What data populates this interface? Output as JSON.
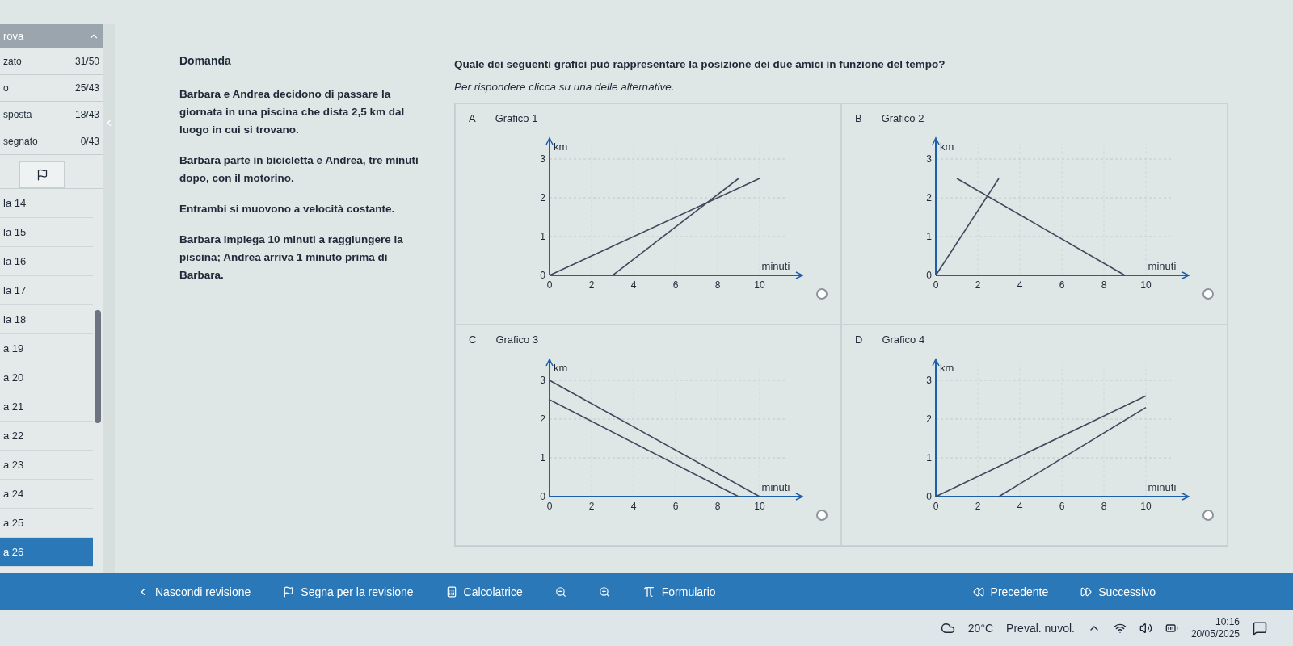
{
  "sidebar": {
    "header": "rova",
    "expanded": true,
    "summary": [
      {
        "label": "zato",
        "count": "31/50"
      },
      {
        "label": "o",
        "count": "25/43"
      },
      {
        "label": "sposta",
        "count": "18/43"
      },
      {
        "label": "segnato",
        "count": "0/43"
      }
    ],
    "questions": [
      {
        "label": "la 14",
        "selected": false
      },
      {
        "label": "la 15",
        "selected": false
      },
      {
        "label": "la 16",
        "selected": false
      },
      {
        "label": "la 17",
        "selected": false
      },
      {
        "label": "la 18",
        "selected": false
      },
      {
        "label": "a 19",
        "selected": false
      },
      {
        "label": "a 20",
        "selected": false
      },
      {
        "label": "a 21",
        "selected": false
      },
      {
        "label": "a 22",
        "selected": false
      },
      {
        "label": "a 23",
        "selected": false
      },
      {
        "label": "a 24",
        "selected": false
      },
      {
        "label": "a 25",
        "selected": false
      },
      {
        "label": "a 26",
        "selected": true
      }
    ]
  },
  "question": {
    "title": "Domanda",
    "paragraphs": [
      "Barbara e Andrea decidono di passare la giornata in una piscina che dista 2,5 km dal luogo in cui si trovano.",
      "Barbara parte in bicicletta e Andrea, tre minuti dopo, con il motorino.",
      "Entrambi si muovono a velocità costante.",
      "Barbara impiega 10 minuti a raggiungere la piscina; Andrea arriva 1 minuto prima di Barbara."
    ]
  },
  "answer": {
    "prompt": "Quale dei seguenti grafici può rappresentare la posizione dei due amici in funzione del tempo?",
    "hint": "Per rispondere clicca su una delle alternative.",
    "options": [
      {
        "letter": "A",
        "title": "Grafico 1",
        "selected": false,
        "chart_data": {
          "type": "line",
          "xlabel": "minuti",
          "ylabel": "km",
          "x": [
            0,
            3,
            9,
            10
          ],
          "series": [
            {
              "color": "#3d4a5c",
              "values": [
                0,
                0.75,
                2.25,
                2.5
              ]
            },
            {
              "color": "#3d4a5c",
              "values": [
                null,
                0,
                2.5,
                null
              ]
            }
          ],
          "grid": true,
          "xlim": [
            0,
            12
          ],
          "ylim": [
            0,
            3.5
          ],
          "xticks": [
            0,
            2,
            4,
            6,
            8,
            10
          ],
          "yticks": [
            0,
            1,
            2,
            3
          ]
        }
      },
      {
        "letter": "B",
        "title": "Grafico 2",
        "selected": false,
        "chart_data": {
          "type": "line",
          "xlabel": "minuti",
          "ylabel": "km",
          "x": [
            0,
            1,
            3,
            9
          ],
          "series": [
            {
              "color": "#3d4a5c",
              "values": [
                0,
                null,
                2.5,
                null
              ]
            },
            {
              "color": "#3d4a5c",
              "values": [
                null,
                2.5,
                null,
                0
              ]
            }
          ],
          "grid": true,
          "xlim": [
            0,
            12
          ],
          "ylim": [
            0,
            3.5
          ],
          "xticks": [
            0,
            2,
            4,
            6,
            8,
            10
          ],
          "yticks": [
            0,
            1,
            2,
            3
          ]
        }
      },
      {
        "letter": "C",
        "title": "Grafico 3",
        "selected": false,
        "chart_data": {
          "type": "line",
          "xlabel": "minuti",
          "ylabel": "km",
          "x": [
            0,
            9,
            10
          ],
          "series": [
            {
              "color": "#3d4a5c",
              "values": [
                3,
                null,
                0
              ]
            },
            {
              "color": "#3d4a5c",
              "values": [
                2.5,
                0,
                null
              ]
            }
          ],
          "grid": true,
          "xlim": [
            0,
            12
          ],
          "ylim": [
            0,
            3.5
          ],
          "xticks": [
            0,
            2,
            4,
            6,
            8,
            10
          ],
          "yticks": [
            0,
            1,
            2,
            3
          ]
        }
      },
      {
        "letter": "D",
        "title": "Grafico 4",
        "selected": false,
        "chart_data": {
          "type": "line",
          "xlabel": "minuti",
          "ylabel": "km",
          "x": [
            0,
            3,
            10
          ],
          "series": [
            {
              "color": "#3d4a5c",
              "values": [
                0,
                null,
                2.6
              ]
            },
            {
              "color": "#3d4a5c",
              "values": [
                null,
                0,
                2.3
              ]
            }
          ],
          "grid": true,
          "xlim": [
            0,
            12
          ],
          "ylim": [
            0,
            3.5
          ],
          "xticks": [
            0,
            2,
            4,
            6,
            8,
            10
          ],
          "yticks": [
            0,
            1,
            2,
            3
          ]
        }
      }
    ]
  },
  "toolbar": {
    "hide_review": "Nascondi revisione",
    "flag": "Segna per la revisione",
    "calculator": "Calcolatrice",
    "formulas": "Formulario",
    "previous": "Precedente",
    "next": "Successivo"
  },
  "taskbar": {
    "temperature": "20°C",
    "weather": "Preval. nuvol.",
    "time": "10:16",
    "date": "20/05/2025"
  }
}
